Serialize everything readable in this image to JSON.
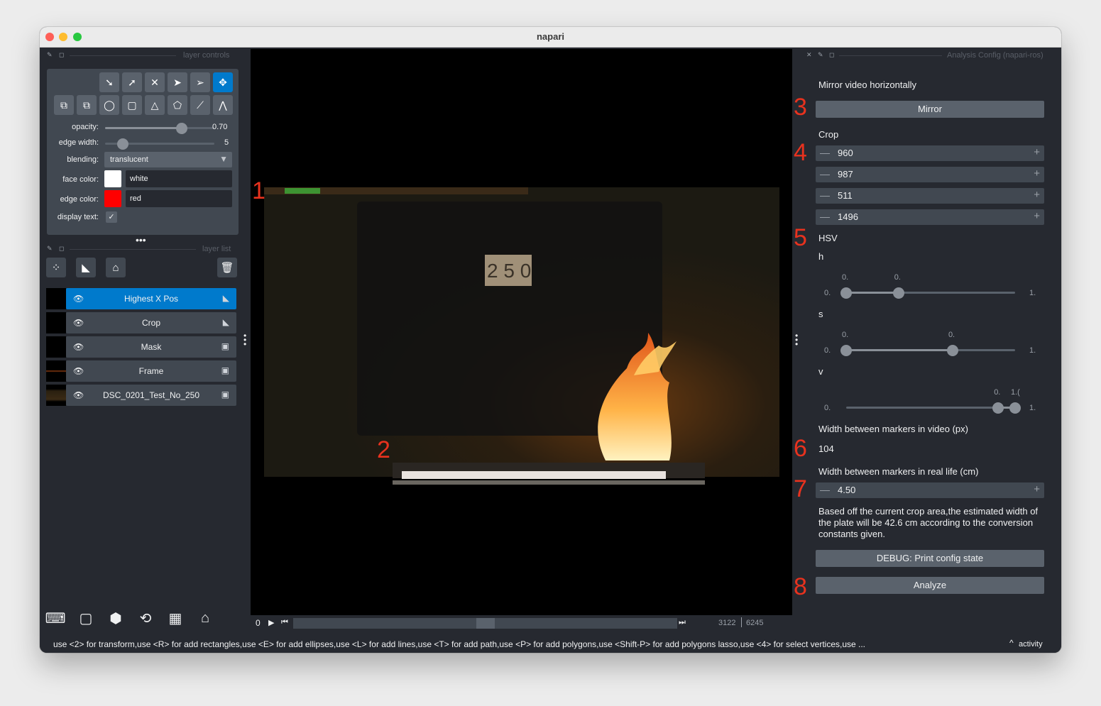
{
  "window": {
    "title": "napari"
  },
  "layer_controls": {
    "header": "layer controls",
    "opacity_label": "opacity:",
    "opacity_value": "0.70",
    "opacity_level": 0.7,
    "edge_width_label": "edge width:",
    "edge_width_value": "5",
    "blending_label": "blending:",
    "blending_value": "translucent",
    "face_color_label": "face color:",
    "face_color_value": "white",
    "face_color_hex": "#ffffff",
    "edge_color_label": "edge color:",
    "edge_color_value": "red",
    "edge_color_hex": "#ff0000",
    "display_text_label": "display text:"
  },
  "layer_list": {
    "header": "layer list",
    "layers": [
      {
        "name": "Highest X Pos",
        "type": "shapes",
        "selected": true
      },
      {
        "name": "Crop",
        "type": "shapes",
        "selected": false
      },
      {
        "name": "Mask",
        "type": "image",
        "selected": false
      },
      {
        "name": "Frame",
        "type": "image",
        "selected": false
      },
      {
        "name": "DSC_0201_Test_No_250",
        "type": "image",
        "selected": false
      }
    ]
  },
  "annotations": [
    "1",
    "2",
    "3",
    "4",
    "5",
    "6",
    "7",
    "8"
  ],
  "dims_slider": {
    "axis": "0",
    "current": "3122",
    "total": "6245",
    "level": 0.5
  },
  "status_bar": {
    "text": "use <2> for transform,use <R> for add rectangles,use <E> for add ellipses,use <L> for add lines,use <T> for add path,use <P> for add polygons,use <Shift-P> for add polygons lasso,use <4> for select vertices,use ...",
    "activity": "activity"
  },
  "analysis_config": {
    "header": "Analysis Config (napari-ros)",
    "mirror_label": "Mirror video horizontally",
    "mirror_button": "Mirror",
    "crop_label": "Crop",
    "crop_values": [
      "960",
      "987",
      "511",
      "1496"
    ],
    "hsv_label": "HSV",
    "h_label": "h",
    "s_label": "s",
    "v_label": "v",
    "hsv_sliders": {
      "h": {
        "min_label": "0.",
        "max_label": "1.",
        "lo_label": "0.",
        "hi_label": "0.",
        "lo": 0.0,
        "hi": 0.31
      },
      "s": {
        "min_label": "0.",
        "max_label": "1.",
        "lo_label": "0.",
        "hi_label": "0.",
        "lo": 0.0,
        "hi": 0.63
      },
      "v": {
        "min_label": "0.",
        "max_label": "1.",
        "lo_label": "0.",
        "hi_label": "1.(",
        "lo": 0.9,
        "hi": 1.0
      }
    },
    "width_video_label": "Width between markers in video (px)",
    "width_video_value": "104",
    "width_real_label": "Width between markers in real life (cm)",
    "width_real_value": "4.50",
    "estimate_text": "Based off the current crop area,the estimated width of the plate will be 42.6 cm according to the conversion constants given.",
    "debug_button": "DEBUG: Print config state",
    "analyze_button": "Analyze"
  }
}
